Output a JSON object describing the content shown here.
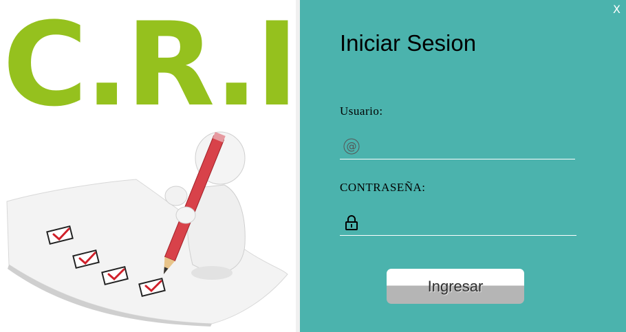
{
  "colors": {
    "panel": "#4bb3ad",
    "logo": "#95c11e",
    "accent_red": "#d0202a"
  },
  "logo": {
    "text": "C.R.I."
  },
  "window": {
    "close_label": "X"
  },
  "login": {
    "title": "Iniciar Sesion",
    "user_label": "Usuario:",
    "user_value": "",
    "user_icon": "at-icon",
    "pass_label": "CONTRASEÑA:",
    "pass_value": "",
    "pass_icon": "lock-icon",
    "submit_label": "Ingresar"
  }
}
